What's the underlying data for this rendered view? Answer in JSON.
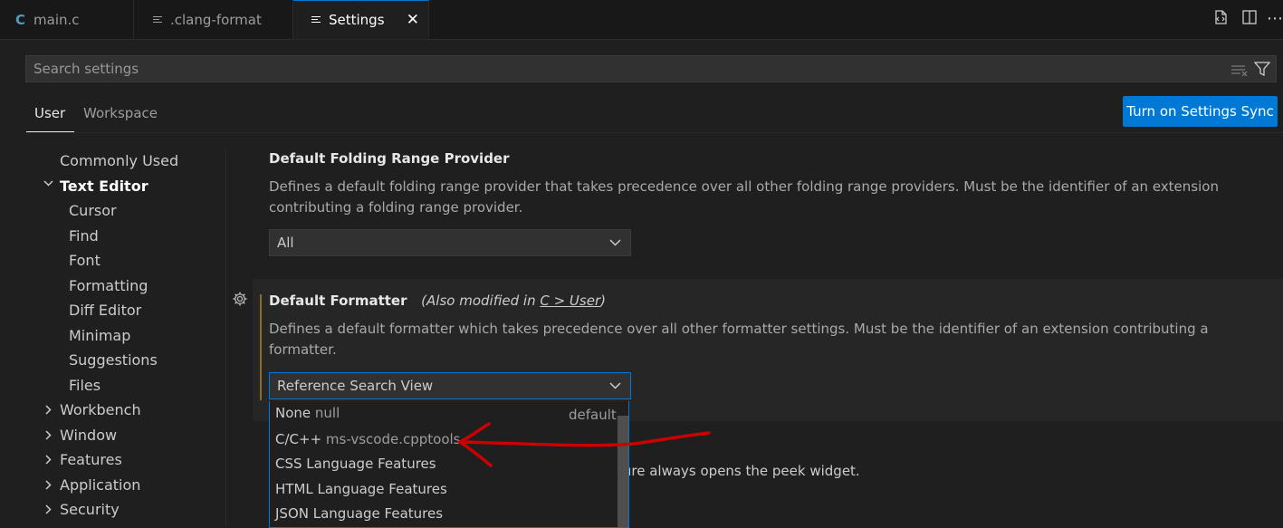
{
  "tabs": [
    {
      "label": "main.c",
      "icon": "c-file-icon"
    },
    {
      "label": ".clang-format",
      "icon": "lines-file-icon"
    },
    {
      "label": "Settings",
      "icon": "lines-file-icon"
    }
  ],
  "search": {
    "placeholder": "Search settings",
    "value": ""
  },
  "scope_tabs": {
    "user": "User",
    "workspace": "Workspace"
  },
  "sync_button": "Turn on Settings Sync",
  "toc": {
    "commonly_used": "Commonly Used",
    "text_editor": "Text Editor",
    "children": [
      "Cursor",
      "Find",
      "Font",
      "Formatting",
      "Diff Editor",
      "Minimap",
      "Suggestions",
      "Files"
    ],
    "collapsed": [
      "Workbench",
      "Window",
      "Features",
      "Application",
      "Security"
    ]
  },
  "folding": {
    "title": "Default Folding Range Provider",
    "description": "Defines a default folding range provider that takes precedence over all other folding range providers. Must be the identifier of an extension contributing a folding range provider.",
    "value": "All"
  },
  "formatter": {
    "title": "Default Formatter",
    "modified_prefix": "(Also modified in ",
    "modified_link": "C > User",
    "modified_suffix": ")",
    "description": "Defines a default formatter which takes precedence over all other formatter settings. Must be the identifier of an extension contributing a formatter.",
    "value": "Reference Search View"
  },
  "options": [
    {
      "label": "None",
      "sub": "null"
    },
    {
      "label": "C/C++",
      "sub": "ms-vscode.cpptools"
    },
    {
      "label": "CSS Language Features",
      "sub": ""
    },
    {
      "label": "HTML Language Features",
      "sub": ""
    },
    {
      "label": "JSON Language Features",
      "sub": ""
    }
  ],
  "options_default": "default",
  "peek_text": "ture always opens the peek widget.",
  "colors": {
    "accent": "#0078d4",
    "annotation": "#cc0000",
    "modified_bar": "#8b6b28"
  }
}
